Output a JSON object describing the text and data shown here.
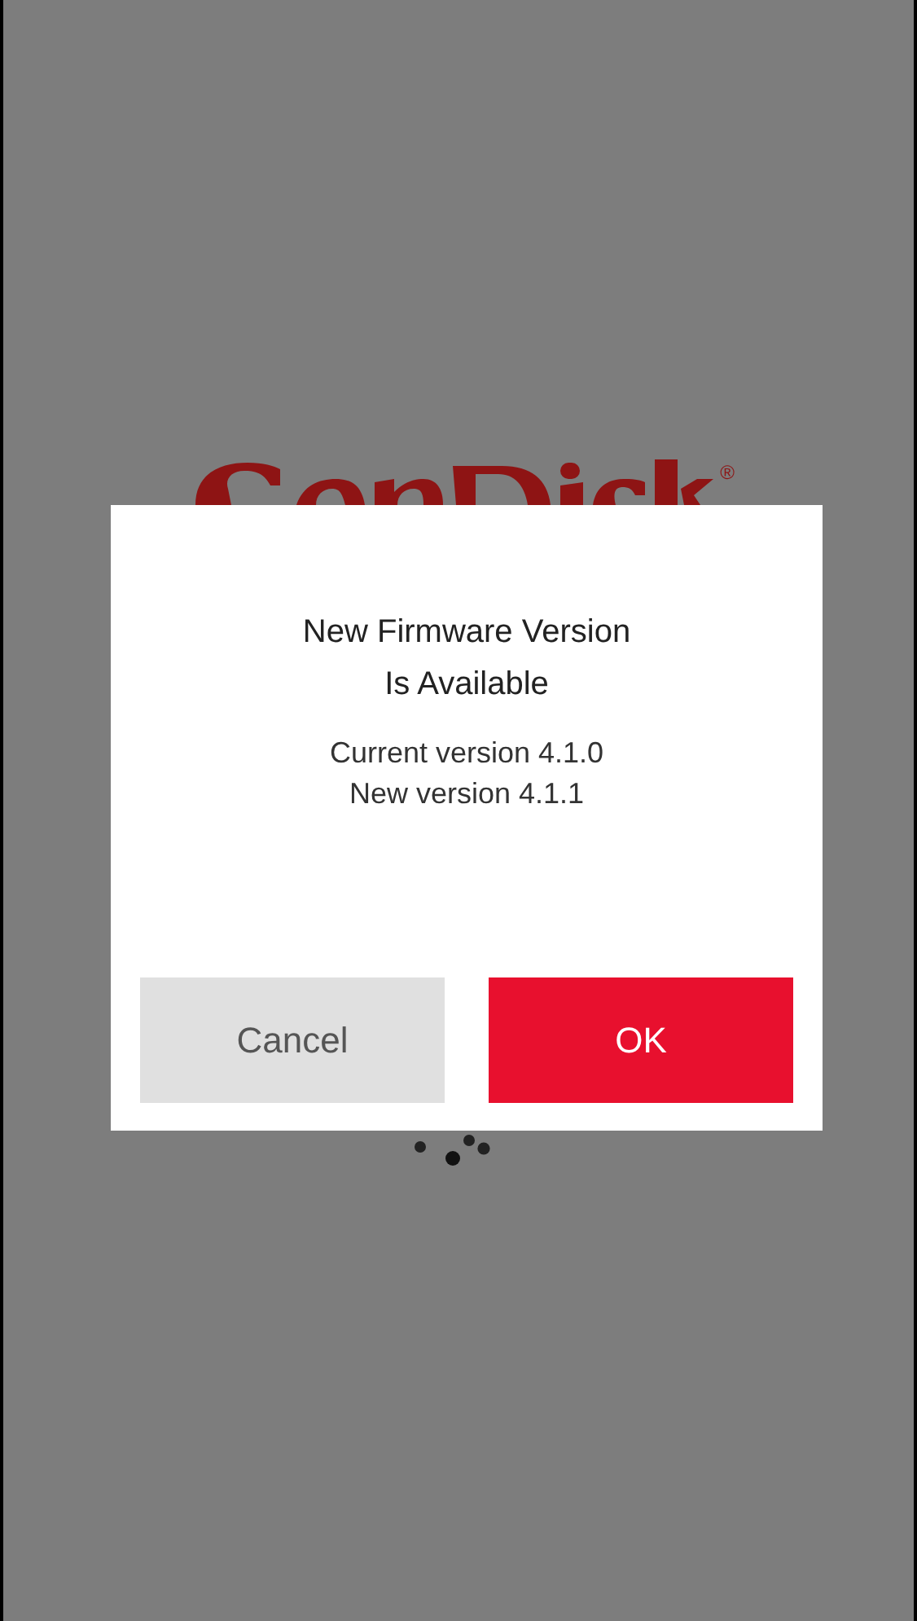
{
  "background": {
    "logo_mark": "®"
  },
  "dialog": {
    "title": "New Firmware Version\nIs Available",
    "lines": [
      "Current version 4.1.0",
      "New version 4.1.1"
    ],
    "buttons": [
      {
        "label": "Cancel",
        "kind": "secondary"
      },
      {
        "label": "OK",
        "kind": "primary"
      }
    ]
  }
}
